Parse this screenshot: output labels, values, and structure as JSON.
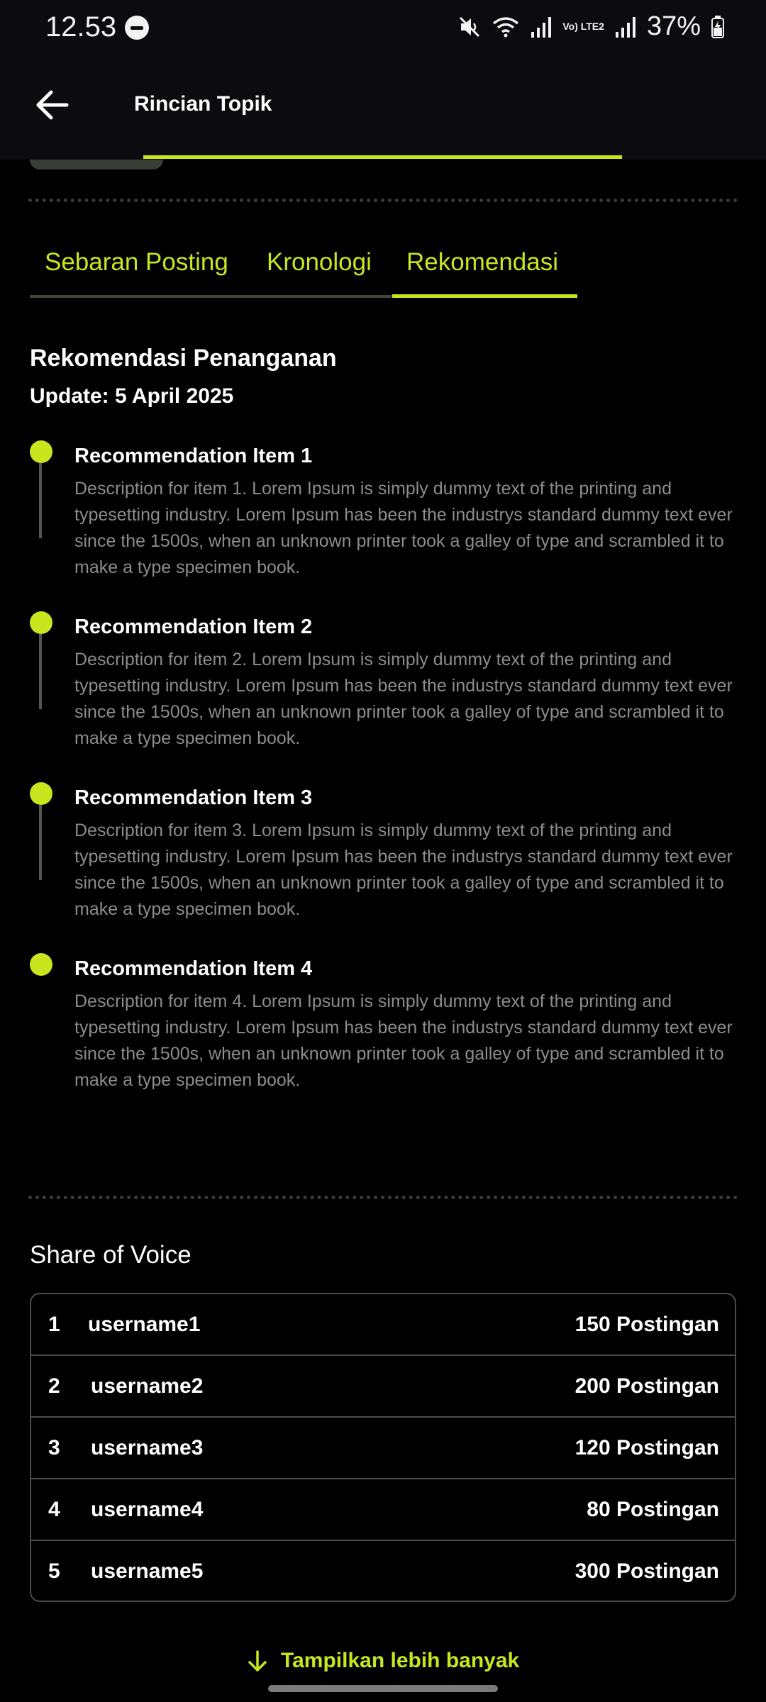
{
  "status_bar": {
    "time": "12.53",
    "battery": "37%",
    "network_label": "Vo) LTE2"
  },
  "app_bar": {
    "title": "Rincian Topik"
  },
  "tabs": [
    {
      "label": "Sebaran Posting",
      "active": false
    },
    {
      "label": "Kronologi",
      "active": false
    },
    {
      "label": "Rekomendasi",
      "active": true
    }
  ],
  "recommendations": {
    "heading": "Rekomendasi Penanganan",
    "update": "Update: 5 April 2025",
    "items": [
      {
        "title": "Recommendation Item 1",
        "description": "Description for item 1. Lorem Ipsum is simply dummy text of the printing and typesetting industry. Lorem Ipsum has been the industrys standard dummy text ever since the 1500s, when an unknown printer took a galley of type and scrambled it to make a type specimen book."
      },
      {
        "title": "Recommendation Item 2",
        "description": "Description for item 2. Lorem Ipsum is simply dummy text of the printing and typesetting industry. Lorem Ipsum has been the industrys standard dummy text ever since the 1500s, when an unknown printer took a galley of type and scrambled it to make a type specimen book."
      },
      {
        "title": "Recommendation Item 3",
        "description": "Description for item 3. Lorem Ipsum is simply dummy text of the printing and typesetting industry. Lorem Ipsum has been the industrys standard dummy text ever since the 1500s, when an unknown printer took a galley of type and scrambled it to make a type specimen book."
      },
      {
        "title": "Recommendation Item 4",
        "description": "Description for item 4. Lorem Ipsum is simply dummy text of the printing and typesetting industry. Lorem Ipsum has been the industrys standard dummy text ever since the 1500s, when an unknown printer took a galley of type and scrambled it to make a type specimen book."
      }
    ]
  },
  "share_of_voice": {
    "heading": "Share of Voice",
    "rows": [
      {
        "rank": "1",
        "username": "username1",
        "posts": "150 Postingan"
      },
      {
        "rank": "2",
        "username": "username2",
        "posts": "200 Postingan"
      },
      {
        "rank": "3",
        "username": "username3",
        "posts": "120 Postingan"
      },
      {
        "rank": "4",
        "username": "username4",
        "posts": "80 Postingan"
      },
      {
        "rank": "5",
        "username": "username5",
        "posts": "300 Postingan"
      }
    ],
    "show_more_label": "Tampilkan lebih banyak"
  },
  "colors": {
    "accent": "#c8e51e",
    "background": "#000000",
    "app_bar": "#0b0b10",
    "muted_text": "#8c8c8c",
    "border": "#4b4b4b"
  },
  "icons": {
    "back": "arrow-left-icon",
    "show_more": "arrow-down-icon",
    "dnd": "do-not-disturb-icon",
    "mute": "mute-icon",
    "wifi": "wifi-icon",
    "signal": "signal-icon",
    "battery": "battery-charging-icon"
  }
}
